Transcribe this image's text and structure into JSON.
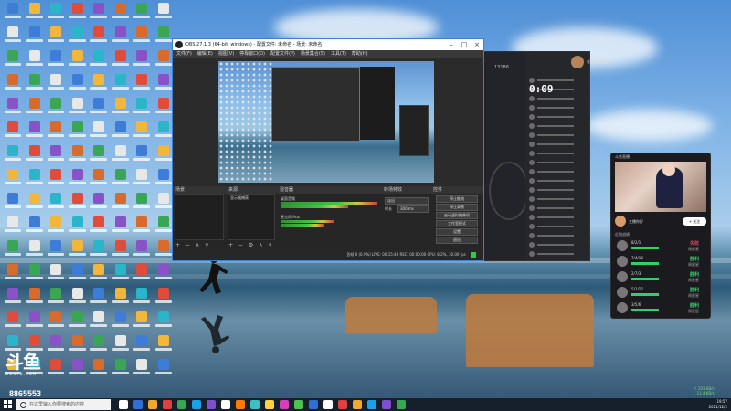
{
  "obs": {
    "title": "OBS 27.1.3 (64-bit, windows) - 配置文件: 未命名 - 场景: 未命名",
    "menu": [
      "文件(F)",
      "编辑(E)",
      "视图(V)",
      "停靠窗口(D)",
      "配置文件(P)",
      "场景集合(S)",
      "工具(T)",
      "帮助(H)"
    ],
    "panels": {
      "scenes": "场景",
      "sources": "来源",
      "mixer": "混音器",
      "transitions": "转场特效",
      "controls": "控件"
    },
    "source_item": "显示器捕获",
    "mixer_tracks": [
      "桌面音频",
      "麦克风/Aux"
    ],
    "transition_value": "淡出",
    "duration_label": "时长",
    "duration_value": "300 ms",
    "control_buttons": [
      "停止推流",
      "停止录制",
      "启动虚拟摄像机",
      "工作室模式",
      "设置",
      "退出"
    ],
    "status": "丢帧 0 (0.0%)   LIVE: 00:15:48   REC: 00:00:00   CPU: 8.2%, 30.00 fps"
  },
  "dark_app": {
    "viewer_count": "13186",
    "timer": "0:09",
    "top_user": "老板你的直播"
  },
  "widget": {
    "header": "斗鱼直播",
    "host_name": "主播你好",
    "follow": "+ 关注",
    "section": "近期战绩",
    "rows": [
      {
        "name": "8/2/1",
        "result": "失败",
        "sub": "周星星",
        "color": "#e0415a"
      },
      {
        "name": "7/4/10",
        "result": "胜利",
        "sub": "周星星",
        "color": "#35d26f"
      },
      {
        "name": "2/7/3",
        "result": "胜利",
        "sub": "周星星",
        "color": "#35d26f"
      },
      {
        "name": "5/1/12",
        "result": "胜利",
        "sub": "周星星",
        "color": "#35d26f"
      },
      {
        "name": "3/5/6",
        "result": "胜利",
        "sub": "周星星",
        "color": "#35d26f"
      }
    ]
  },
  "watermark": {
    "logo": "斗鱼",
    "sub": "DOUYU.COM",
    "room_id": "8865553"
  },
  "taskbar": {
    "search_placeholder": "在这里输入你要搜索的内容",
    "time": "19:57",
    "date": "2021/12/2"
  },
  "net_speed": {
    "up": "↑ 203 KB/s",
    "down": "↓ 11.4 KB/s"
  }
}
